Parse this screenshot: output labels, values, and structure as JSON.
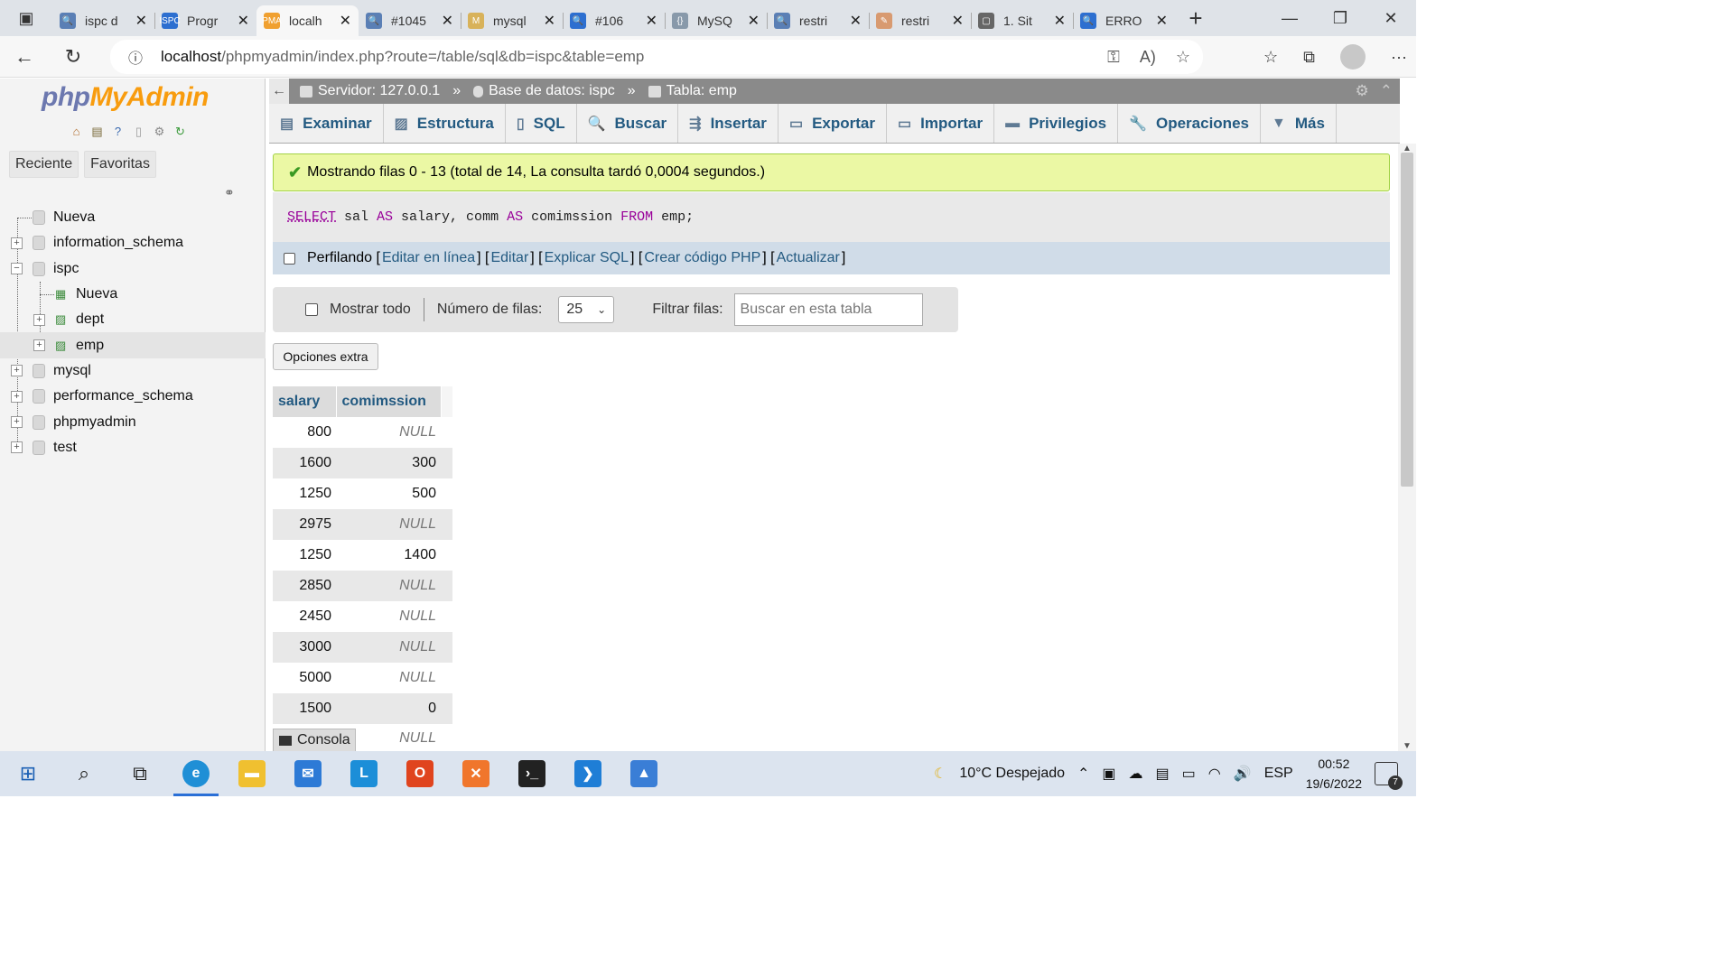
{
  "browser": {
    "tabs": [
      {
        "title": "ispc d",
        "fav_color": "#5a7fb5",
        "fav_char": "🔍"
      },
      {
        "title": "Progr",
        "fav_color": "#2d6fd0",
        "fav_char": "ISPC"
      },
      {
        "title": "localh",
        "fav_color": "#f0a030",
        "fav_char": "PMA",
        "active": true
      },
      {
        "title": "#1045",
        "fav_color": "#5a7fb5",
        "fav_char": "🔍"
      },
      {
        "title": "mysql",
        "fav_color": "#d8b25a",
        "fav_char": "M"
      },
      {
        "title": "#106",
        "fav_color": "#2d6fd0",
        "fav_char": "🔍"
      },
      {
        "title": "MySQ",
        "fav_color": "#8899aa",
        "fav_char": "{}"
      },
      {
        "title": "restri",
        "fav_color": "#5a7fb5",
        "fav_char": "🔍"
      },
      {
        "title": "restri",
        "fav_color": "#d89a70",
        "fav_char": "✎"
      },
      {
        "title": "1. Sit",
        "fav_color": "#666666",
        "fav_char": "▢"
      },
      {
        "title": "ERRO",
        "fav_color": "#2d6fd0",
        "fav_char": "🔍"
      }
    ],
    "url_host": "localhost",
    "url_path": "/phpmyadmin/index.php?route=/table/sql&db=ispc&table=emp"
  },
  "sidebar": {
    "logo_php": "php",
    "logo_myadmin": "MyAdmin",
    "tab_recent": "Reciente",
    "tab_favorites": "Favoritas",
    "tree": {
      "nueva": "Nueva",
      "information_schema": "information_schema",
      "ispc": "ispc",
      "ispc_nueva": "Nueva",
      "dept": "dept",
      "emp": "emp",
      "mysql": "mysql",
      "performance_schema": "performance_schema",
      "phpmyadmin": "phpmyadmin",
      "test": "test"
    }
  },
  "breadcrumb": {
    "server": "Servidor: 127.0.0.1",
    "database": "Base de datos: ispc",
    "table": "Tabla: emp",
    "separator": "»"
  },
  "menu": {
    "examinar": "Examinar",
    "estructura": "Estructura",
    "sql": "SQL",
    "buscar": "Buscar",
    "insertar": "Insertar",
    "exportar": "Exportar",
    "importar": "Importar",
    "privilegios": "Privilegios",
    "operaciones": "Operaciones",
    "mas": "Más"
  },
  "message": {
    "success": "Mostrando filas 0 - 13 (total de 14, La consulta tardó 0,0004 segundos.)"
  },
  "query": {
    "select": "SELECT",
    "part1": " sal ",
    "as1": "AS",
    "part2": " salary, comm ",
    "as2": "AS",
    "part3": " comimssion ",
    "from": "FROM",
    "part4": " emp;"
  },
  "profiling": {
    "label": "Perfilando",
    "edit_inline": "Editar en línea",
    "edit": "Editar",
    "explain": "Explicar SQL",
    "create_php": "Crear código PHP",
    "refresh": "Actualizar"
  },
  "filters": {
    "show_all": "Mostrar todo",
    "rows_label": "Número de filas:",
    "rows_value": "25",
    "filter_label": "Filtrar filas:",
    "filter_placeholder": "Buscar en esta tabla"
  },
  "extra_options": "Opciones extra",
  "results": {
    "columns": [
      "salary",
      "comimssion"
    ],
    "rows": [
      [
        "800",
        "NULL"
      ],
      [
        "1600",
        "300"
      ],
      [
        "1250",
        "500"
      ],
      [
        "2975",
        "NULL"
      ],
      [
        "1250",
        "1400"
      ],
      [
        "2850",
        "NULL"
      ],
      [
        "2450",
        "NULL"
      ],
      [
        "3000",
        "NULL"
      ],
      [
        "5000",
        "NULL"
      ],
      [
        "1500",
        "0"
      ]
    ],
    "partial_last": "NULL"
  },
  "console_label": "Consola",
  "taskbar": {
    "weather": "10°C  Despejado",
    "lang": "ESP",
    "time": "00:52",
    "date": "19/6/2022",
    "notifications": "7"
  }
}
